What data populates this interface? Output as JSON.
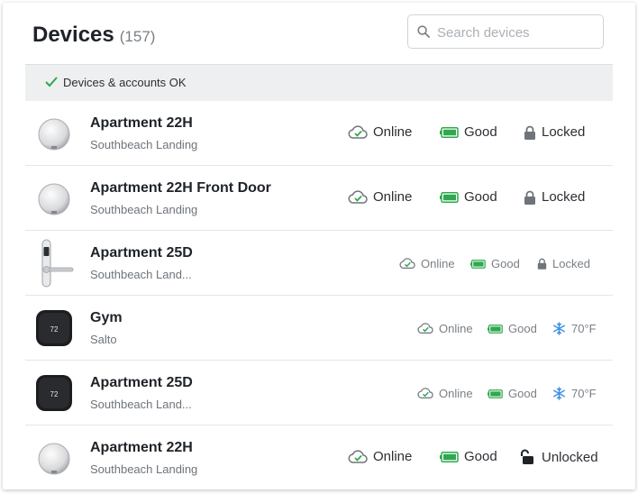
{
  "header": {
    "title": "Devices",
    "count": "(157)"
  },
  "search": {
    "placeholder": "Search devices",
    "value": ""
  },
  "banner": {
    "text": "Devices & accounts OK"
  },
  "colors": {
    "ok_green": "#2fa84f",
    "battery_green": "#2fa84f",
    "snow_blue": "#3b8fe0",
    "icon_gray": "#6e747a"
  },
  "devices": [
    {
      "name": "Apartment 22H",
      "location": "Southbeach Landing",
      "device_icon": "round-lock",
      "status": "Online",
      "battery": "Good",
      "lock": "Locked",
      "lock_icon": "lock-icon"
    },
    {
      "name": "Apartment 22H Front Door",
      "location": "Southbeach Landing",
      "device_icon": "round-lock",
      "status": "Online",
      "battery": "Good",
      "lock": "Locked",
      "lock_icon": "lock-icon"
    },
    {
      "name": "Apartment 25D",
      "location": "Southbeach Land...",
      "device_icon": "door-handle",
      "status": "Online",
      "battery": "Good",
      "lock": "Locked",
      "lock_icon": "lock-icon"
    },
    {
      "name": "Gym",
      "location": "Salto",
      "device_icon": "thermostat",
      "thermostat_display": "72",
      "status": "Online",
      "battery": "Good",
      "temperature": "70°F",
      "mode_icon": "snowflake-icon"
    },
    {
      "name": "Apartment 25D",
      "location": "Southbeach Land...",
      "device_icon": "thermostat",
      "thermostat_display": "72",
      "status": "Online",
      "battery": "Good",
      "temperature": "70°F",
      "mode_icon": "snowflake-icon"
    },
    {
      "name": "Apartment 22H",
      "location": "Southbeach Landing",
      "device_icon": "round-lock",
      "status": "Online",
      "battery": "Good",
      "lock": "Unlocked",
      "lock_icon": "unlock-icon"
    }
  ]
}
